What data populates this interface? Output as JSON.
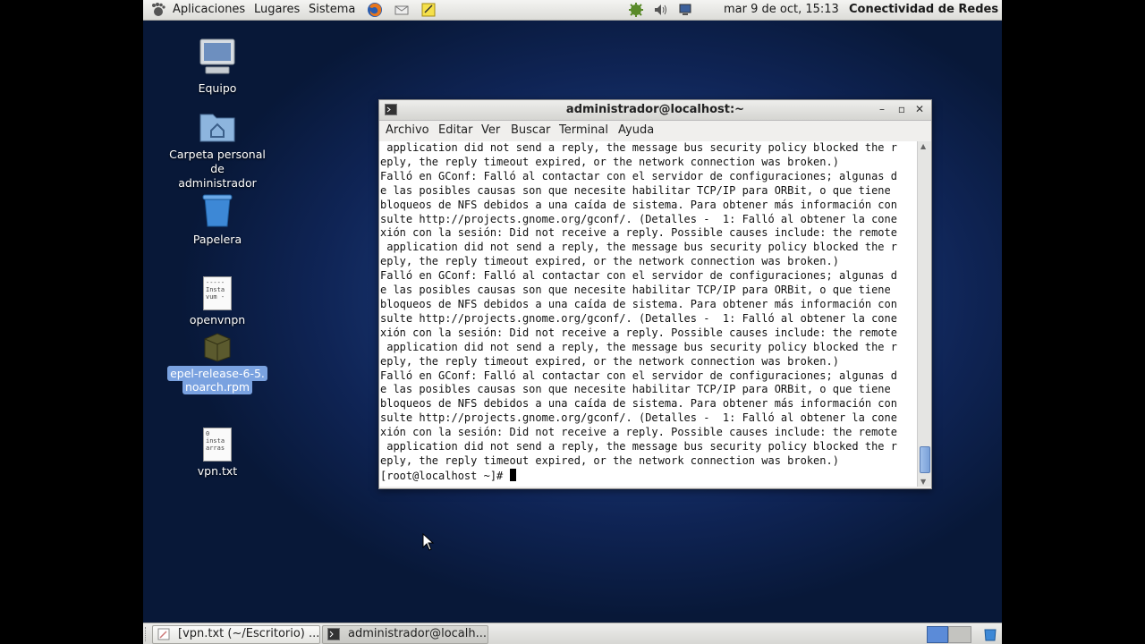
{
  "top_panel": {
    "menus": [
      "Aplicaciones",
      "Lugares",
      "Sistema"
    ],
    "clock": "mar  9 de oct, 15:13",
    "user": "Conectividad de Redes"
  },
  "desktop_icons": {
    "equipo": "Equipo",
    "home_line1": "Carpeta personal de",
    "home_line2": "administrador",
    "trash": "Papelera",
    "openvnpn": "openvnpn",
    "openvnpn_preview": "-----\nInsta\nvum -",
    "rpm_line1": "epel-release-6-5.",
    "rpm_line2": "noarch.rpm",
    "vpn": "vpn.txt",
    "vpn_preview": "0\ninsta\narras"
  },
  "terminal": {
    "title": "administrador@localhost:~",
    "menu": [
      "Archivo",
      "Editar",
      "Ver",
      "Buscar",
      "Terminal",
      "Ayuda"
    ],
    "lines": [
      " application did not send a reply, the message bus security policy blocked the r",
      "eply, the reply timeout expired, or the network connection was broken.)",
      "Falló en GConf: Falló al contactar con el servidor de configuraciones; algunas d",
      "e las posibles causas son que necesite habilitar TCP/IP para ORBit, o que tiene ",
      "bloqueos de NFS debidos a una caída de sistema. Para obtener más información con",
      "sulte http://projects.gnome.org/gconf/. (Detalles -  1: Falló al obtener la cone",
      "xión con la sesión: Did not receive a reply. Possible causes include: the remote",
      " application did not send a reply, the message bus security policy blocked the r",
      "eply, the reply timeout expired, or the network connection was broken.)",
      "Falló en GConf: Falló al contactar con el servidor de configuraciones; algunas d",
      "e las posibles causas son que necesite habilitar TCP/IP para ORBit, o que tiene ",
      "bloqueos de NFS debidos a una caída de sistema. Para obtener más información con",
      "sulte http://projects.gnome.org/gconf/. (Detalles -  1: Falló al obtener la cone",
      "xión con la sesión: Did not receive a reply. Possible causes include: the remote",
      " application did not send a reply, the message bus security policy blocked the r",
      "eply, the reply timeout expired, or the network connection was broken.)",
      "Falló en GConf: Falló al contactar con el servidor de configuraciones; algunas d",
      "e las posibles causas son que necesite habilitar TCP/IP para ORBit, o que tiene ",
      "bloqueos de NFS debidos a una caída de sistema. Para obtener más información con",
      "sulte http://projects.gnome.org/gconf/. (Detalles -  1: Falló al obtener la cone",
      "xión con la sesión: Did not receive a reply. Possible causes include: the remote",
      " application did not send a reply, the message bus security policy blocked the r",
      "eply, the reply timeout expired, or the network connection was broken.)"
    ],
    "prompt": "[root@localhost ~]# "
  },
  "taskbar": {
    "tasks": [
      "[vpn.txt (~/Escritorio) ...",
      "administrador@localh..."
    ]
  }
}
